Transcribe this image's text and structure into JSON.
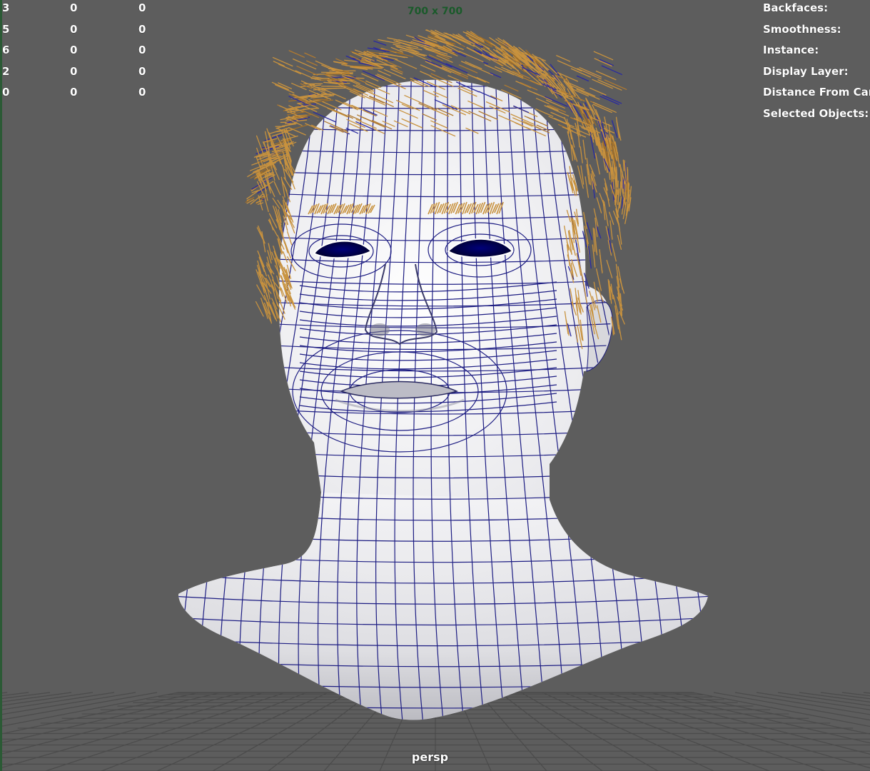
{
  "viewport": {
    "resolution_gate": "700 x 700",
    "camera": "persp",
    "colors": {
      "background": "#5d5d5d",
      "wireframe": "#1a1a7a",
      "hair": "#c8923e",
      "skin": "#e9e9ec",
      "grid": "#4a4a4a",
      "resolution_text": "#1a5a2a"
    }
  },
  "hud_stats": [
    [
      "3",
      "0",
      "0"
    ],
    [
      "5",
      "0",
      "0"
    ],
    [
      "6",
      "0",
      "0"
    ],
    [
      "2",
      "0",
      "0"
    ],
    [
      "0",
      "0",
      "0"
    ]
  ],
  "hud_info": [
    "Backfaces:",
    "Smoothness:",
    "Instance:",
    "Display Layer:",
    "Distance From Can",
    "Selected Objects:"
  ]
}
